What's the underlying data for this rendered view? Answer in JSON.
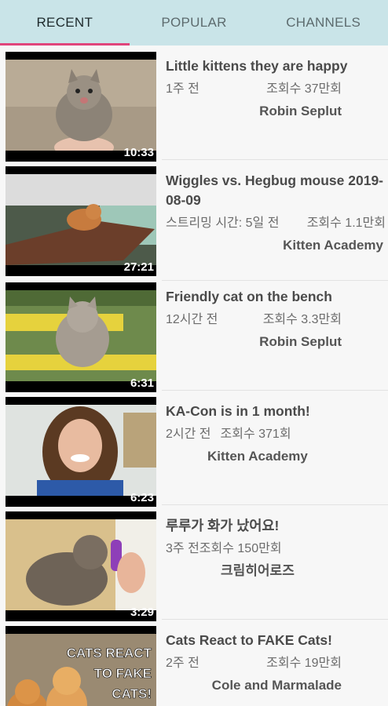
{
  "tabs": [
    {
      "label": "RECENT",
      "active": true
    },
    {
      "label": "POPULAR",
      "active": false
    },
    {
      "label": "CHANNELS",
      "active": false
    }
  ],
  "accent_color": "#e0457b",
  "tabbar_color": "#c9e4e8",
  "videos": [
    {
      "title": "Little kittens they are happy",
      "ago": "1주 전",
      "views": "조회수 37만회",
      "channel": "Robin Seplut",
      "duration": "10:33"
    },
    {
      "title": "Wiggles vs. Hegbug mouse 2019-08-09",
      "ago": "스트리밍 시간: 5일 전",
      "views": "조회수 1.1만회",
      "channel": "Kitten Academy",
      "duration": "27:21"
    },
    {
      "title": "Friendly cat on the bench",
      "ago": "12시간 전",
      "views": "조회수 3.3만회",
      "channel": "Robin Seplut",
      "duration": "6:31"
    },
    {
      "title": "KA-Con is in 1 month!",
      "ago": "2시간 전",
      "views": "조회수 371회",
      "channel": "Kitten Academy",
      "duration": "6:23"
    },
    {
      "title": "루루가 화가 났어요!",
      "ago": "3주 전",
      "views": "조회수 150만회",
      "channel": "크림히어로즈",
      "duration": "3:29"
    },
    {
      "title": "Cats React to FAKE Cats!",
      "ago": "2주 전",
      "views": "조회수 19만회",
      "channel": "Cole and Marmalade",
      "duration": ""
    }
  ],
  "thumb_text": [
    "CATS REACT",
    "TO FAKE",
    "CATS!"
  ]
}
